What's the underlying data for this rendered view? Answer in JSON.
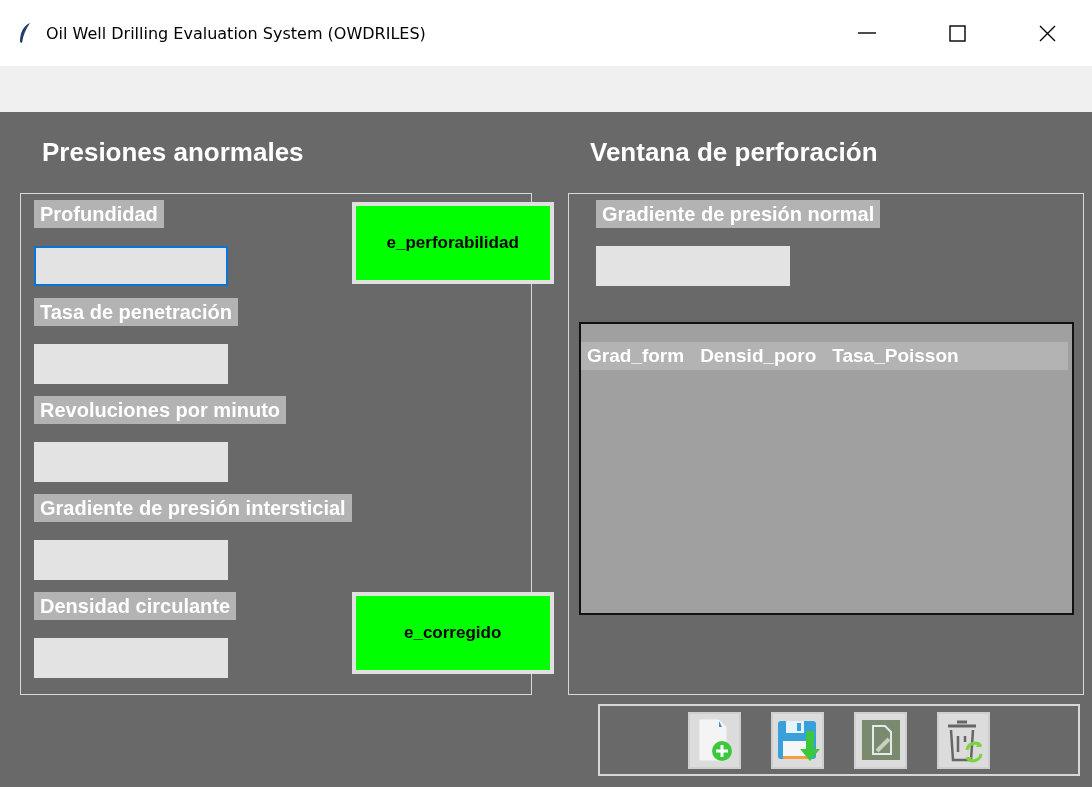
{
  "window": {
    "title": "Oil Well Drilling Evaluation System (OWDRILES)",
    "controls": [
      {
        "kind": "minimize"
      },
      {
        "kind": "maximize"
      },
      {
        "kind": "close"
      }
    ]
  },
  "left_panel": {
    "heading": "Presiones anormales",
    "fields": [
      {
        "label": "Profundidad",
        "focused": true
      },
      {
        "label": "Tasa de penetración",
        "focused": false
      },
      {
        "label": "Revoluciones por minuto",
        "focused": false
      },
      {
        "label": "Gradiente de presión intersticial",
        "focused": false
      },
      {
        "label": "Densidad circulante",
        "focused": false
      }
    ],
    "buttons": [
      "e_perforabilidad",
      "e_corregido"
    ]
  },
  "right_panel": {
    "heading": "Ventana de perforación",
    "field": {
      "label": "Gradiente de presión normal",
      "focused": false
    },
    "table": {
      "columns": [
        "Grad_form",
        "Densid_poro",
        "Tasa_Poisson"
      ]
    }
  },
  "toolbar": [
    {
      "kind": "new"
    },
    {
      "kind": "save"
    },
    {
      "kind": "edit"
    },
    {
      "kind": "delete"
    }
  ]
}
